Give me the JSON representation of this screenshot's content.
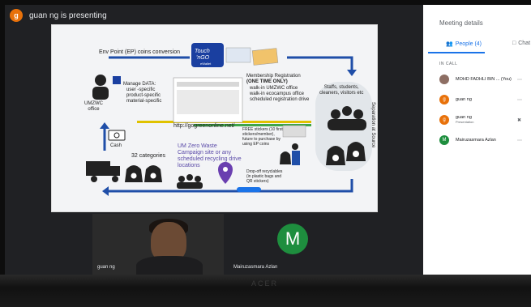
{
  "presenting": {
    "initial": "g",
    "text": "guan ng is presenting"
  },
  "slide": {
    "title": "Env Point (EP) coins conversion",
    "brand_top": "Touch",
    "brand_mid": "'nGO",
    "brand_bot": "eWallet",
    "office_label": "UMZWC\noffice",
    "manage_title": "Manage DATA:",
    "manage_items": [
      "user -specific",
      "product-specific",
      "material-specific"
    ],
    "membership_title": "Membership Registration",
    "membership_sub": "(ONE TIME ONLY)",
    "membership_items": [
      "walk-in UMZWC office",
      "walk-in ecocampus office",
      "scheduled registration drive"
    ],
    "staff_label": "Staffs, students,\ncleaners, visitors etc",
    "url": "http://gogreenonline.net/",
    "separation": "Separation at Source",
    "cash_label": "Cash",
    "categories": "32 categories",
    "campaign_text": "UM Zero Waste\nCampaign site or any\nscheduled recycling drive\nlocations",
    "free_stickers": "FREE stickers (10 first\nstickers/member),\nfuture to purchase by\nusing EP coins",
    "dropoff": "Drop-off recyclables\n(in plastic bags and\nQR stickers)"
  },
  "tiles": {
    "guan_name": "guan ng",
    "mai_initial": "M",
    "mai_name": "Mairuzasmara Azlan"
  },
  "panel": {
    "title": "Meeting details",
    "people_tab": "People (4)",
    "chat_tab": "Chat",
    "in_call": "IN CALL",
    "participants": [
      {
        "name": "MOHD FADHLI BIN ... (You)",
        "sub": "",
        "color": "#8d6e63",
        "initial": "",
        "icon": ""
      },
      {
        "name": "guan ng",
        "sub": "",
        "color": "#e8710a",
        "initial": "g",
        "icon": ""
      },
      {
        "name": "guan ng",
        "sub": "Presentation",
        "color": "#e8710a",
        "initial": "g",
        "icon": "mic-off-icon"
      },
      {
        "name": "Mairuzasmara Azlan",
        "sub": "",
        "color": "#1e8e3e",
        "initial": "M",
        "icon": ""
      }
    ]
  },
  "bezel_logo": "ACER"
}
